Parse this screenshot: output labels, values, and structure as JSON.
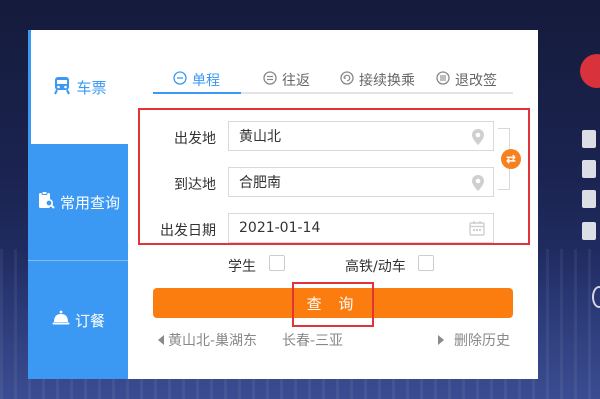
{
  "sidebar": {
    "items": [
      {
        "label": "车票",
        "icon": "train-icon"
      },
      {
        "label": "常用查询",
        "icon": "clipboard-search-icon"
      },
      {
        "label": "订餐",
        "icon": "dining-cloche-icon"
      }
    ]
  },
  "tabs": [
    {
      "label": "单程",
      "icon": "minus-circle-icon"
    },
    {
      "label": "往返",
      "icon": "equals-circle-icon"
    },
    {
      "label": "接续换乘",
      "icon": "refresh-circle-icon"
    },
    {
      "label": "退改签",
      "icon": "list-circle-icon"
    }
  ],
  "form": {
    "from_label": "出发地",
    "from_value": "黄山北",
    "to_label": "到达地",
    "to_value": "合肥南",
    "date_label": "出发日期",
    "date_value": "2021-01-14",
    "swap_icon": "⇄"
  },
  "options": {
    "student_label": "学生",
    "highspeed_label": "高铁/动车"
  },
  "search_button": "查 询",
  "history": {
    "items": [
      "黄山北-巢湖东",
      "长春-三亚"
    ],
    "clear_label": "删除历史"
  },
  "colors": {
    "primary": "#3b99f4",
    "accent": "#fb7d10",
    "highlight": "#e0333a"
  }
}
